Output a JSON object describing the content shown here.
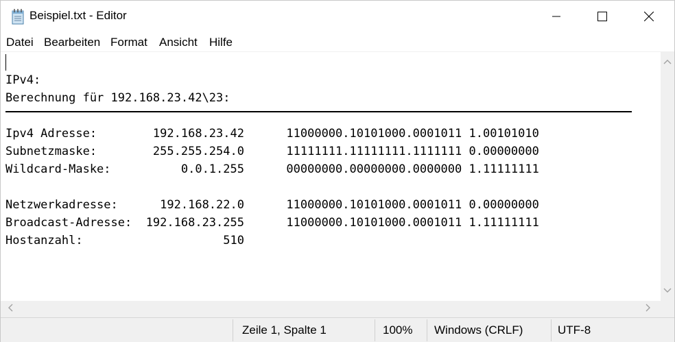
{
  "window": {
    "title": "Beispiel.txt - Editor"
  },
  "icons": {
    "app": "notepad-icon",
    "minimize": "minimize-icon",
    "maximize": "maximize-icon",
    "close": "close-icon",
    "scroll_up": "chevron-up-icon",
    "scroll_down": "chevron-down-icon",
    "scroll_left": "chevron-left-icon",
    "scroll_right": "chevron-right-icon"
  },
  "menu": {
    "file": "Datei",
    "edit": "Bearbeiten",
    "format": "Format",
    "view": "Ansicht",
    "help": "Hilfe"
  },
  "document": {
    "lines": [
      "IPv4:",
      "Berechnung für 192.168.23.42\\23:",
      "",
      "Ipv4 Adresse:        192.168.23.42      11000000.10101000.0001011 1.00101010",
      "Subnetzmaske:        255.255.254.0      11111111.11111111.1111111 0.00000000",
      "Wildcard-Maske:          0.0.1.255      00000000.00000000.0000000 1.11111111",
      "",
      "Netzwerkadresse:      192.168.22.0      11000000.10101000.0001011 0.00000000",
      "Broadcast-Adresse:  192.168.23.255      11000000.10101000.0001011 1.11111111",
      "Hostanzahl:                    510"
    ]
  },
  "status": {
    "position": "Zeile 1, Spalte 1",
    "zoom": "100%",
    "line_ending": "Windows (CRLF)",
    "encoding": "UTF-8"
  }
}
